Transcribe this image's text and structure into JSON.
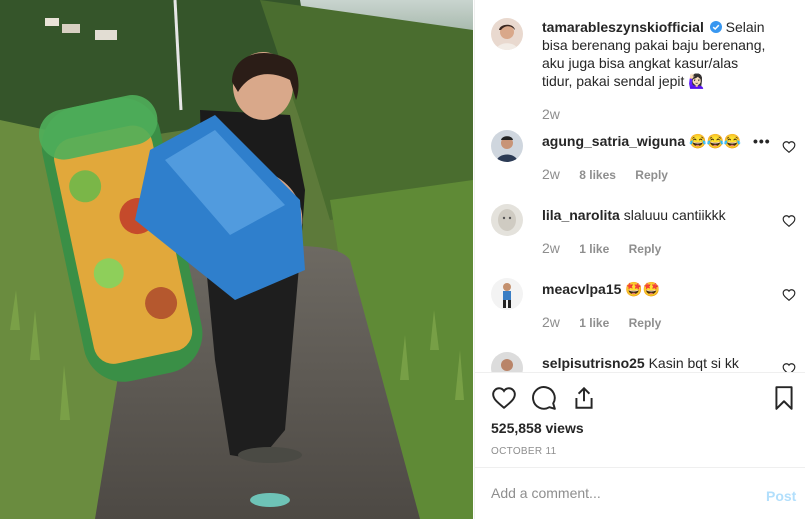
{
  "post": {
    "username": "tamarableszynskiofficial",
    "caption": "Selain bisa berenang pakai baju berenang, aku juga bisa angkat kasur/alas tidur, pakai sendal jepit 🙋🏻‍♀️",
    "timestamp": "2w"
  },
  "comments": [
    {
      "username": "agung_satria_wiguna",
      "text": "😂😂😂",
      "time": "2w",
      "likes": "8 likes",
      "reply": "Reply"
    },
    {
      "username": "lila_narolita",
      "text": "slaluuu cantiikkk",
      "time": "2w",
      "likes": "1 like",
      "reply": "Reply"
    },
    {
      "username": "meacvlpa15",
      "text": "🤩🤩",
      "time": "2w",
      "likes": "1 like",
      "reply": "Reply"
    },
    {
      "username": "selpisutrisno25",
      "text": "Kasin bqt si kk"
    }
  ],
  "more_symbol": "•••",
  "stats": {
    "views": "525,858 views",
    "date": "OCTOBER 11"
  },
  "add_comment": {
    "placeholder": "Add a comment...",
    "post_label": "Post"
  },
  "colors": {
    "verified": "#3897f0",
    "muted": "#8e8e8e",
    "post_disabled": "#b2dffc",
    "border": "#efefef"
  }
}
